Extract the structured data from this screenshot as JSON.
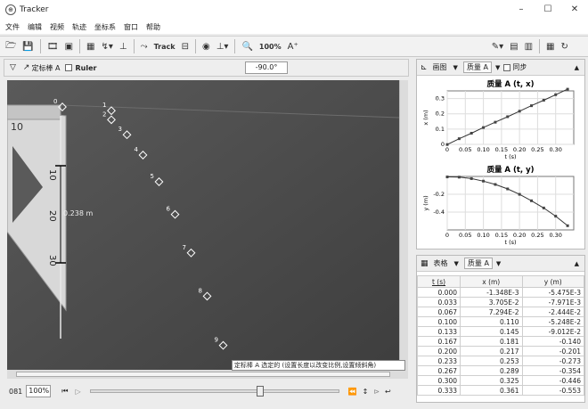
{
  "window": {
    "title": "Tracker",
    "minimize": "–",
    "maximize": "☐",
    "close": "✕"
  },
  "menu": [
    "文件",
    "编辑",
    "视频",
    "轨迹",
    "坐标系",
    "窗口",
    "帮助"
  ],
  "toolbar": {
    "track_label": "Track",
    "zoom_label": "100%"
  },
  "subbar": {
    "axes_label": "定标棒 A",
    "ruler_label": "Ruler",
    "angle": "-90.0°"
  },
  "video": {
    "ruler_length": "0.238 m",
    "ruler_ticks": [
      "10",
      "10",
      "20",
      "30"
    ],
    "points": [
      {
        "label": "0",
        "x": 0.0,
        "y": 0.0
      },
      {
        "label": "1",
        "x": 0.11,
        "y": -0.007
      },
      {
        "label": "2",
        "x": 0.11,
        "y": -0.024
      },
      {
        "label": "3",
        "x": 0.145,
        "y": -0.052
      },
      {
        "label": "4",
        "x": 0.181,
        "y": -0.09
      },
      {
        "label": "5",
        "x": 0.217,
        "y": -0.14
      },
      {
        "label": "6",
        "x": 0.253,
        "y": -0.201
      },
      {
        "label": "7",
        "x": 0.289,
        "y": -0.273
      },
      {
        "label": "8",
        "x": 0.325,
        "y": -0.354
      },
      {
        "label": "9",
        "x": 0.361,
        "y": -0.446
      }
    ],
    "caption": "定标棒 A 选定的 (设置长度以改变比例,设置倾斜角)"
  },
  "player": {
    "frame": "081",
    "zoom": "100%"
  },
  "plot_panel": {
    "view_label": "画图",
    "track_label": "质量 A",
    "sync_label": "同步"
  },
  "chart_data": [
    {
      "type": "line",
      "title": "质量 A (t, x)",
      "xlabel": "t (s)",
      "ylabel": "x (m)",
      "xlim": [
        0,
        0.35
      ],
      "ylim": [
        0,
        0.35
      ],
      "xticks": [
        "0",
        "0.05",
        "0.10",
        "0.15",
        "0.20",
        "0.25",
        "0.30"
      ],
      "yticks": [
        "0",
        "0.1",
        "0.2",
        "0.3"
      ],
      "x": [
        0.0,
        0.033,
        0.067,
        0.1,
        0.133,
        0.167,
        0.2,
        0.233,
        0.267,
        0.3,
        0.333
      ],
      "y": [
        -0.0013,
        0.037,
        0.073,
        0.11,
        0.145,
        0.181,
        0.217,
        0.253,
        0.289,
        0.325,
        0.361
      ]
    },
    {
      "type": "line",
      "title": "质量 A (t, y)",
      "xlabel": "t (s)",
      "ylabel": "y (m)",
      "xlim": [
        0,
        0.35
      ],
      "ylim": [
        -0.6,
        0
      ],
      "xticks": [
        "0",
        "0.05",
        "0.10",
        "0.15",
        "0.20",
        "0.25",
        "0.30"
      ],
      "yticks": [
        "-0.2",
        "-0.4"
      ],
      "x": [
        0.0,
        0.033,
        0.067,
        0.1,
        0.133,
        0.167,
        0.2,
        0.233,
        0.267,
        0.3,
        0.333
      ],
      "y": [
        -0.0055,
        -0.008,
        -0.0244,
        -0.0525,
        -0.09,
        -0.14,
        -0.201,
        -0.273,
        -0.354,
        -0.446,
        -0.553
      ]
    }
  ],
  "table_panel": {
    "view_label": "表格",
    "track_label": "质量 A"
  },
  "table": {
    "headers": [
      "t (s)",
      "x (m)",
      "y (m)"
    ],
    "rows": [
      [
        "0.000",
        "-1.348E-3",
        "-5.475E-3"
      ],
      [
        "0.033",
        "3.705E-2",
        "-7.971E-3"
      ],
      [
        "0.067",
        "7.294E-2",
        "-2.444E-2"
      ],
      [
        "0.100",
        "0.110",
        "-5.248E-2"
      ],
      [
        "0.133",
        "0.145",
        "-9.012E-2"
      ],
      [
        "0.167",
        "0.181",
        "-0.140"
      ],
      [
        "0.200",
        "0.217",
        "-0.201"
      ],
      [
        "0.233",
        "0.253",
        "-0.273"
      ],
      [
        "0.267",
        "0.289",
        "-0.354"
      ],
      [
        "0.300",
        "0.325",
        "-0.446"
      ],
      [
        "0.333",
        "0.361",
        "-0.553"
      ]
    ]
  }
}
